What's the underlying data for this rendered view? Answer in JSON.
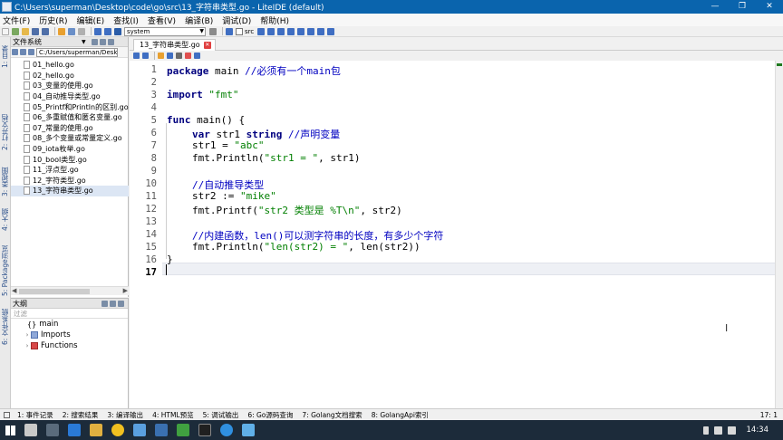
{
  "window": {
    "title": "C:\\Users\\superman\\Desktop\\code\\go\\src\\13_字符串类型.go - LiteIDE (default)",
    "buttons": [
      "—",
      "❐",
      "✕"
    ]
  },
  "menu": [
    "文件(F)",
    "历史(R)",
    "编辑(E)",
    "查找(I)",
    "查看(V)",
    "编译(B)",
    "调试(D)",
    "帮助(H)"
  ],
  "toolbar": {
    "env_combo": "system",
    "src_label": "src"
  },
  "left_tabs": [
    "1: 目录",
    "2: 打开文档",
    "3: 类视图",
    "4: 大纲",
    "5: Package浏览",
    "6: 文件系统"
  ],
  "file_panel": {
    "title": "文件系统",
    "path": "C:/Users/superman/Deskt",
    "files": [
      "01_hello.go",
      "02_hello.go",
      "03_变量的使用.go",
      "04_自动推导类型.go",
      "05_Printf和Println的区别.go",
      "06_多重赋值和匿名变量.go",
      "07_常量的使用.go",
      "08_多个变量或常量定义.go",
      "09_iota枚举.go",
      "10_bool类型.go",
      "11_浮点型.go",
      "12_字符类型.go",
      "13_字符串类型.go"
    ],
    "selected_index": 12
  },
  "outline_panel": {
    "title": "大纲",
    "filter_placeholder": "过滤",
    "root": "main",
    "children": [
      "Imports",
      "Functions"
    ]
  },
  "editor": {
    "tab_label": "13_字符串类型.go",
    "line_numbers": [
      "1",
      "2",
      "3",
      "4",
      "5",
      "6",
      "7",
      "8",
      "9",
      "10",
      "11",
      "12",
      "13",
      "14",
      "15",
      "16",
      "17"
    ],
    "current_line": 17,
    "lines": [
      {
        "kw": "package",
        "rest": " main ",
        "comment": "//必须有一个main包"
      },
      {},
      {
        "kw": "import",
        "str": "\"fmt\""
      },
      {},
      {
        "kw": "func",
        "rest": " main() {"
      },
      {
        "kw": "var",
        "rest": " str1 ",
        "type": "string",
        "comment": "//声明变量"
      },
      {
        "pre": "str1 = ",
        "str": "\"abc\""
      },
      {
        "pre": "fmt.Println(",
        "str": "\"str1 = \"",
        "post": ", str1)"
      },
      {},
      {
        "comment": "//自动推导类型"
      },
      {
        "pre": "str2 := ",
        "str": "\"mike\""
      },
      {
        "pre": "fmt.Printf(",
        "str": "\"str2 类型是 %T\\n\"",
        "post": ", str2)"
      },
      {},
      {
        "comment": "//内建函数，len()可以测字符串的长度，有多少个字符"
      },
      {
        "pre": "fmt.Println(",
        "str": "\"len(str2) = \"",
        "post": ", len(str2))"
      },
      {
        "pre": "}"
      },
      {}
    ]
  },
  "bottom_tabs": [
    "1: 事件记录",
    "2: 搜索结果",
    "3: 编译输出",
    "4: HTML预览",
    "5: 调试输出",
    "6: Go源码查询",
    "7: Golang文档搜索",
    "8: GolangApi索引"
  ],
  "status": {
    "position": "17: 1"
  },
  "taskbar": {
    "time": "14:34"
  },
  "colors": {
    "titlebar": "#0a64ad",
    "keyword": "#00007f",
    "string": "#007f00",
    "comment": "#0000c0",
    "taskbar": "#1c2b3a"
  }
}
